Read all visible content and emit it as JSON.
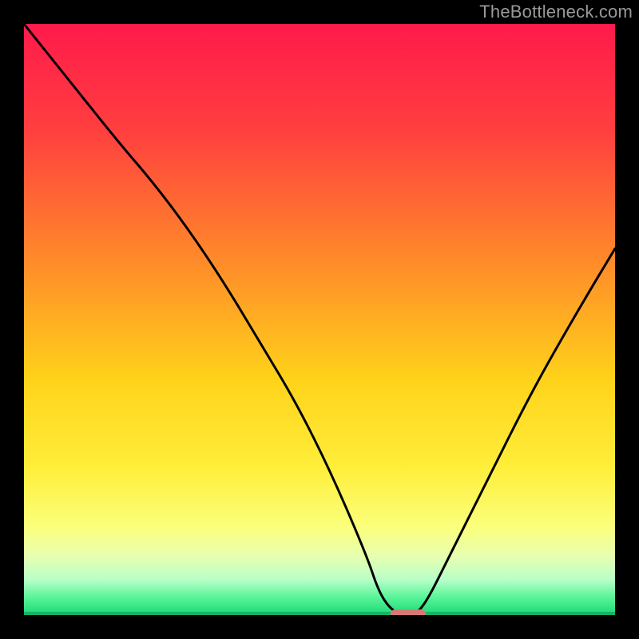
{
  "watermark": "TheBottleneck.com",
  "chart_data": {
    "type": "line",
    "title": "",
    "xlabel": "",
    "ylabel": "",
    "xlim": [
      0,
      100
    ],
    "ylim": [
      0,
      100
    ],
    "grid": false,
    "legend": false,
    "series": [
      {
        "name": "bottleneck-curve",
        "x": [
          0,
          8,
          16,
          22,
          28,
          34,
          40,
          46,
          52,
          58,
          60,
          62,
          64,
          66,
          68,
          72,
          78,
          86,
          94,
          100
        ],
        "values": [
          100,
          90,
          80,
          73,
          65,
          56,
          46,
          36,
          24,
          10,
          4,
          1,
          0,
          0,
          2,
          10,
          22,
          38,
          52,
          62
        ]
      }
    ],
    "marker": {
      "name": "optimal-band",
      "x_center": 65,
      "y": 0,
      "width": 6,
      "color": "#d97873"
    },
    "gradient_stops": [
      {
        "offset": 0.0,
        "color": "#ff1a4b"
      },
      {
        "offset": 0.18,
        "color": "#ff3f3f"
      },
      {
        "offset": 0.4,
        "color": "#ff8a2a"
      },
      {
        "offset": 0.6,
        "color": "#ffd21a"
      },
      {
        "offset": 0.75,
        "color": "#ffee3a"
      },
      {
        "offset": 0.85,
        "color": "#fbff7a"
      },
      {
        "offset": 0.9,
        "color": "#e8ffb0"
      },
      {
        "offset": 0.94,
        "color": "#b8ffc8"
      },
      {
        "offset": 0.97,
        "color": "#58f598"
      },
      {
        "offset": 1.0,
        "color": "#1cd776"
      }
    ],
    "baseline_color": "#16b466"
  }
}
